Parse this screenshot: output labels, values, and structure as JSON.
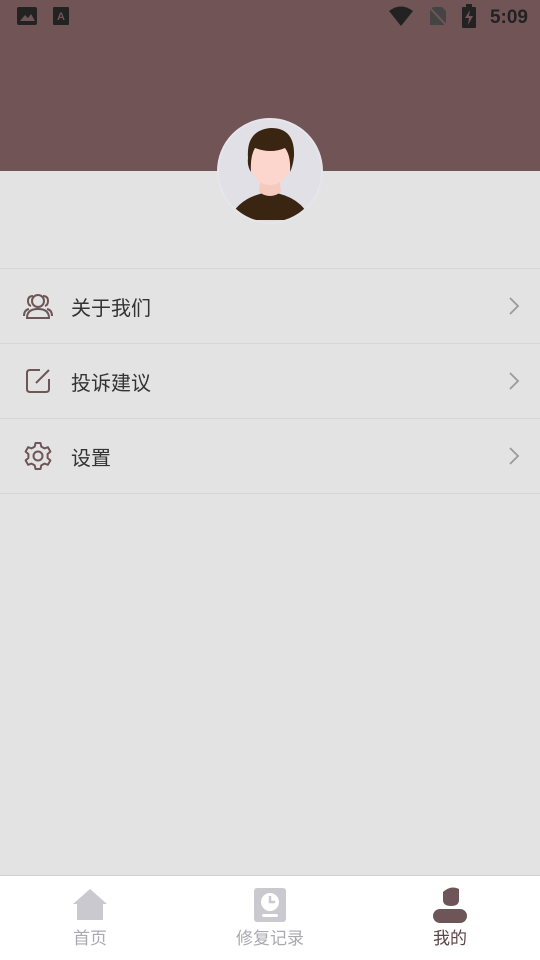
{
  "status_bar": {
    "time": "5:09",
    "icons": [
      "image-icon",
      "font-icon",
      "wifi-icon",
      "no-sim-icon",
      "battery-charging-icon"
    ]
  },
  "colors": {
    "header": "#705456",
    "page_background": "#e3e3e3",
    "icon_accent": "#6e5658",
    "tab_active": "#5a4446",
    "tab_inactive": "#c6c6cc"
  },
  "menu": {
    "items": [
      {
        "label": "关于我们",
        "icon": "users-icon"
      },
      {
        "label": "投诉建议",
        "icon": "edit-icon"
      },
      {
        "label": "设置",
        "icon": "gear-icon"
      }
    ]
  },
  "tabbar": {
    "tabs": [
      {
        "label": "首页",
        "icon": "home-icon",
        "active": false
      },
      {
        "label": "修复记录",
        "icon": "clock-record-icon",
        "active": false
      },
      {
        "label": "我的",
        "icon": "user-icon",
        "active": true
      }
    ]
  }
}
